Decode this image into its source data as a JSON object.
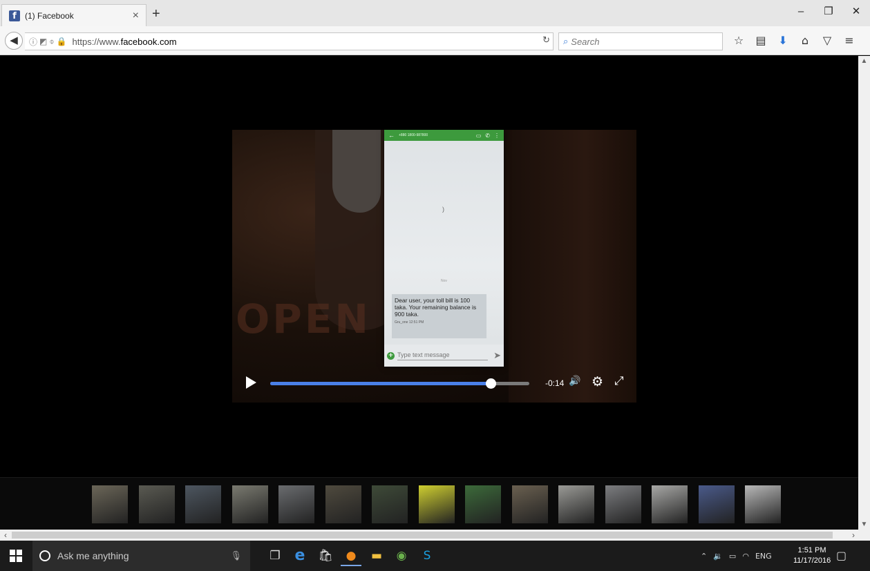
{
  "browser": {
    "tab_title": "(1) Facebook",
    "tab_icon": "f",
    "new_tab": "+",
    "tab_close": "×",
    "window_min": "–",
    "window_max": "❐",
    "window_close": "✕",
    "url_prefix": "https://www.",
    "url_domain": "facebook.com",
    "search_placeholder": "Search",
    "icons": [
      "star-icon",
      "reading-list-icon",
      "download-icon",
      "home-icon",
      "pocket-icon",
      "menu-icon"
    ]
  },
  "video": {
    "sms_header": "+880 1800-987800",
    "sms_message": "Dear user, your toll bill is 100 taka. Your remaining balance is 900 taka.",
    "sms_sender": "Gru_one  12:51 PM",
    "input_placeholder": "Type text message",
    "time_remaining": "-0:14",
    "progress": 0.85,
    "sign_text": "OPEN"
  },
  "thumbnails": {
    "count": 15,
    "colors": [
      "#6b6658",
      "#5a5a52",
      "#4d5660",
      "#7a7a70",
      "#6a6c6f",
      "#4f4a3e",
      "#3e4a38",
      "#cfcf30",
      "#3c6a3a",
      "#6a6050",
      "#9a9a96",
      "#7c7d80",
      "#a8a8a6",
      "#4a5a8a",
      "#b8b8b8"
    ]
  },
  "taskbar": {
    "search_placeholder": "Ask me anything",
    "lang": "ENG",
    "time": "1:51 PM",
    "date": "11/17/2016"
  }
}
